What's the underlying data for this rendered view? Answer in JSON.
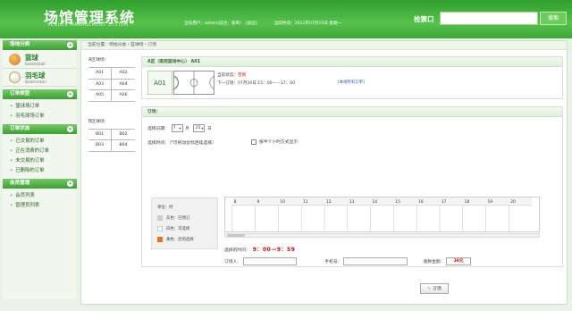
{
  "header": {
    "logo_cn": "场馆管理系统",
    "logo_en": "VENUES MANAGEMENT SYSTEM",
    "user_label": "当前用户：admin(前台：张英)",
    "logout": "[退出]",
    "time_label": "当前时间：2011年07月15日 星期一",
    "ticket_label": "检票口",
    "search_placeholder": "",
    "search_button": "搜索"
  },
  "sidebar": {
    "section_venue": "场地分类",
    "sports": [
      {
        "cn": "篮球",
        "en": "Basketball",
        "icon": "basketball-icon"
      },
      {
        "cn": "羽毛球",
        "en": "Badminton",
        "icon": "badminton-icon"
      }
    ],
    "section_order_type": "订单类型",
    "order_types": [
      "篮球场订单",
      "羽毛球场订单"
    ],
    "section_order_status": "订单状态",
    "order_status": [
      "已交易的订单",
      "正在消费的订单",
      "未交易的订单",
      "已删除的订单"
    ],
    "section_member": "会员管理",
    "member_items": [
      "会员列表",
      "管理员列表"
    ]
  },
  "breadcrumb": "当前位置：场地分类 › 篮球场 › 订场",
  "areas": [
    {
      "label": "A区球场：",
      "courts": [
        "A01",
        "A02",
        "A03",
        "A04",
        "A05",
        "A06"
      ]
    },
    {
      "label": "B区球场：",
      "courts": [
        "B01",
        "B02",
        "B03",
        "B04"
      ]
    }
  ],
  "court_panel": {
    "title": "A区（南苑篮球中心） A01",
    "court_id": "A01",
    "status_label": "当前状态：",
    "status_value": "空闲",
    "next_booking": "下一订场：07月30日 15：00——17：00",
    "view_orders": "[本场所有订单]"
  },
  "booking": {
    "title": "订场：",
    "date_label": "选择日期：",
    "month_value": "7",
    "month_unit": "月",
    "day_value": "25",
    "day_unit": "日",
    "time_label": "选择时间：（*可拖动鼠标连续选择）",
    "half_hour_label": "按半个小时方式显示",
    "legend_unit": "单位：时",
    "legend_items": [
      {
        "label": "灰色：已预订",
        "color": "#cfcfcf"
      },
      {
        "label": "白色：可选择",
        "color": "#ffffff"
      },
      {
        "label": "黄色：您的选择",
        "color": "#e8711a"
      }
    ],
    "hours": [
      "8",
      "9",
      "10",
      "11",
      "12",
      "13",
      "14",
      "15",
      "16",
      "17",
      "18",
      "19",
      "20"
    ],
    "selected_time_label": "选择的时间：",
    "selected_time_value": "9：00—9：59",
    "booker_label": "订场人：",
    "phone_label": "手机号：",
    "amount_label": "收款金额：",
    "amount_value": "30元",
    "submit_label": "订场"
  },
  "colors": {
    "brand_green": "#3da637",
    "status_red": "#d40000"
  }
}
